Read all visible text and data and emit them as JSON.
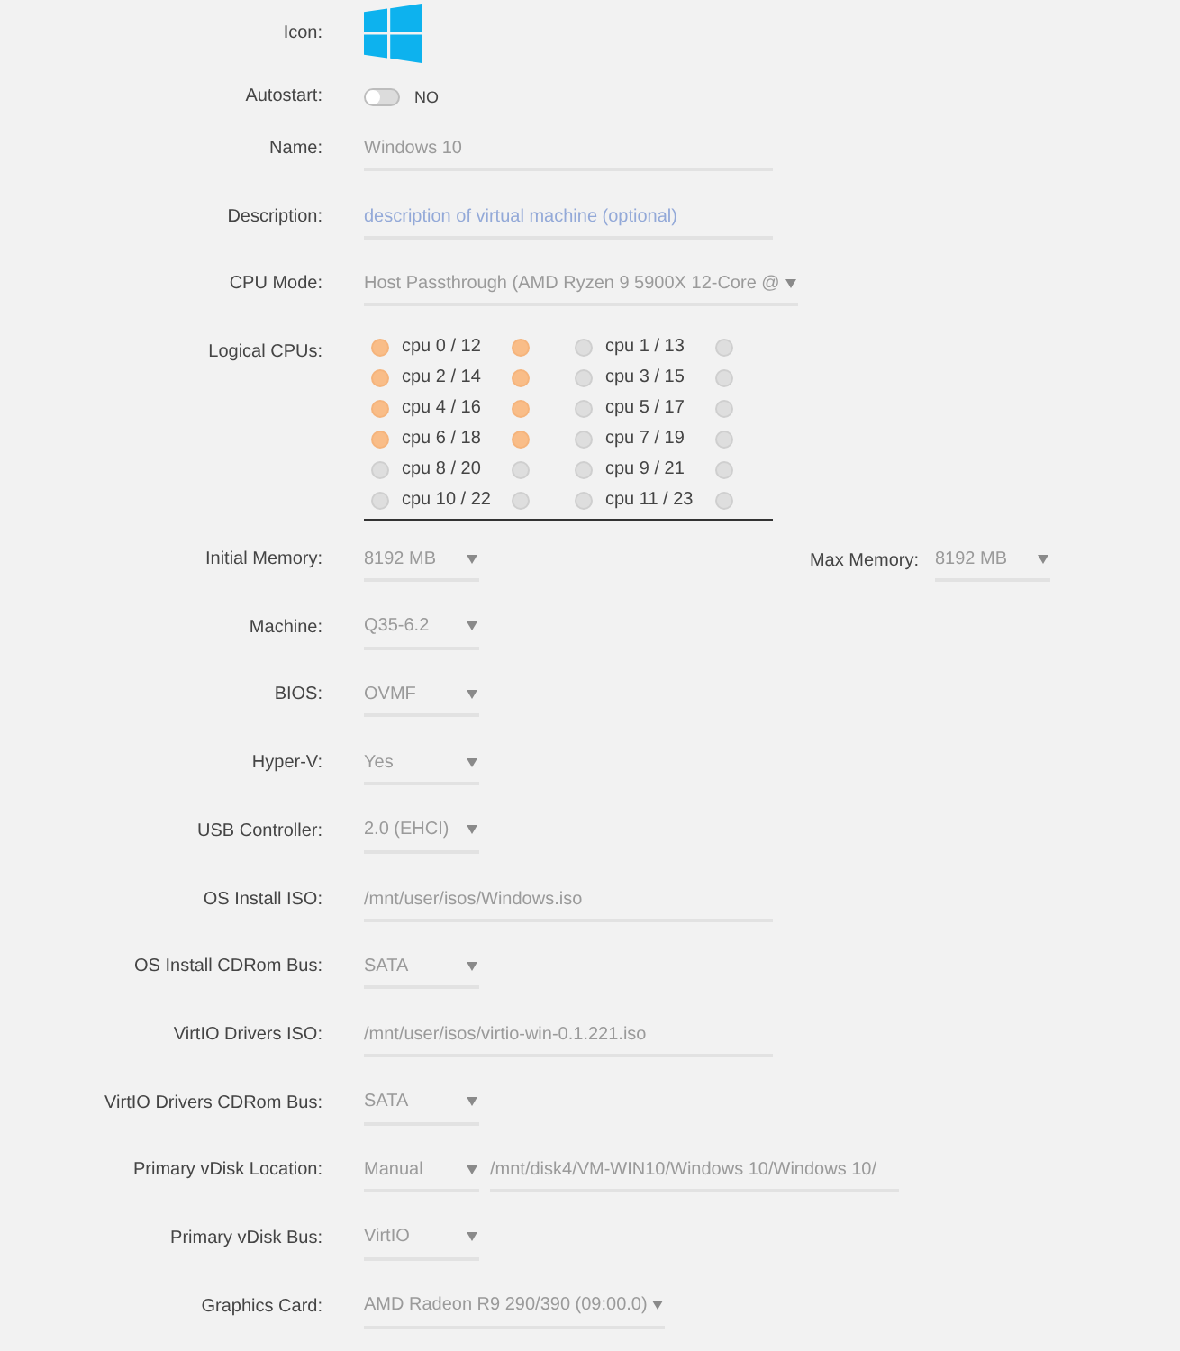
{
  "form": {
    "rows": [
      {
        "label": "Icon:",
        "controls": [
          {
            "kind": "logo"
          }
        ]
      },
      {
        "label": "Autostart:",
        "controls": [
          {
            "kind": "toggle",
            "on": false,
            "text": "NO"
          }
        ]
      },
      {
        "label": "Name:",
        "controls": [
          {
            "kind": "text",
            "value": "Windows 10"
          }
        ]
      },
      {
        "label": "Description:",
        "controls": [
          {
            "kind": "text",
            "placeholder": "description of virtual machine (optional)"
          }
        ]
      },
      {
        "label": "CPU Mode:",
        "controls": [
          {
            "kind": "select",
            "value": "Host Passthrough (AMD Ryzen 9 5900X 12-Core @"
          }
        ]
      },
      {
        "label": "Logical CPUs:",
        "controls": [
          {
            "kind": "cpus",
            "cpus": [
              {
                "label": "cpu 0 / 12",
                "threads": [
                  {
                    "checked": true
                  },
                  {
                    "checked": true
                  }
                ]
              },
              {
                "label": "cpu 1 / 13",
                "threads": [
                  {
                    "checked": false
                  },
                  {
                    "checked": false
                  }
                ]
              },
              {
                "label": "cpu 2 / 14",
                "threads": [
                  {
                    "checked": true
                  },
                  {
                    "checked": true
                  }
                ]
              },
              {
                "label": "cpu 3 / 15",
                "threads": [
                  {
                    "checked": false
                  },
                  {
                    "checked": false
                  }
                ]
              },
              {
                "label": "cpu 4 / 16",
                "threads": [
                  {
                    "checked": true
                  },
                  {
                    "checked": true
                  }
                ]
              },
              {
                "label": "cpu 5 / 17",
                "threads": [
                  {
                    "checked": false
                  },
                  {
                    "checked": false
                  }
                ]
              },
              {
                "label": "cpu 6 / 18",
                "threads": [
                  {
                    "checked": true
                  },
                  {
                    "checked": true
                  }
                ]
              },
              {
                "label": "cpu 7 / 19",
                "threads": [
                  {
                    "checked": false
                  },
                  {
                    "checked": false
                  }
                ]
              },
              {
                "label": "cpu 8 / 20",
                "threads": [
                  {
                    "checked": false
                  },
                  {
                    "checked": false
                  }
                ]
              },
              {
                "label": "cpu 9 / 21",
                "threads": [
                  {
                    "checked": false
                  },
                  {
                    "checked": false
                  }
                ]
              },
              {
                "label": "cpu 10 / 22",
                "threads": [
                  {
                    "checked": false
                  },
                  {
                    "checked": false
                  }
                ]
              },
              {
                "label": "cpu 11 / 23",
                "threads": [
                  {
                    "checked": false
                  },
                  {
                    "checked": false
                  }
                ]
              }
            ]
          }
        ]
      },
      {
        "label": "Initial Memory:",
        "controls": [
          {
            "kind": "select",
            "value": "8192 MB"
          }
        ],
        "aside": {
          "label": "Max Memory:",
          "controls": [
            {
              "kind": "select",
              "value": "8192 MB"
            }
          ]
        }
      },
      {
        "label": "Machine:",
        "controls": [
          {
            "kind": "select",
            "value": "Q35-6.2"
          }
        ]
      },
      {
        "label": "BIOS:",
        "controls": [
          {
            "kind": "select",
            "value": "OVMF"
          }
        ]
      },
      {
        "label": "Hyper-V:",
        "controls": [
          {
            "kind": "select",
            "value": "Yes"
          }
        ]
      },
      {
        "label": "USB Controller:",
        "controls": [
          {
            "kind": "select",
            "value": "2.0 (EHCI)"
          }
        ]
      },
      {
        "label": "OS Install ISO:",
        "controls": [
          {
            "kind": "text",
            "value": "/mnt/user/isos/Windows.iso"
          }
        ]
      },
      {
        "label": "OS Install CDRom Bus:",
        "controls": [
          {
            "kind": "select",
            "value": "SATA"
          }
        ]
      },
      {
        "label": "VirtIO Drivers ISO:",
        "controls": [
          {
            "kind": "text",
            "value": "/mnt/user/isos/virtio-win-0.1.221.iso"
          }
        ]
      },
      {
        "label": "VirtIO Drivers CDRom Bus:",
        "controls": [
          {
            "kind": "select",
            "value": "SATA"
          }
        ]
      },
      {
        "label": "Primary vDisk Location:",
        "controls": [
          {
            "kind": "select",
            "value": "Manual"
          },
          {
            "kind": "text",
            "value": "/mnt/disk4/VM-WIN10/Windows 10/Windows 10/"
          }
        ]
      },
      {
        "label": "Primary vDisk Bus:",
        "controls": [
          {
            "kind": "select",
            "value": "VirtIO"
          }
        ]
      },
      {
        "label": "Graphics Card:",
        "controls": [
          {
            "kind": "select",
            "value": "AMD Radeon R9 290/390 (09:00.0)"
          }
        ]
      }
    ]
  }
}
